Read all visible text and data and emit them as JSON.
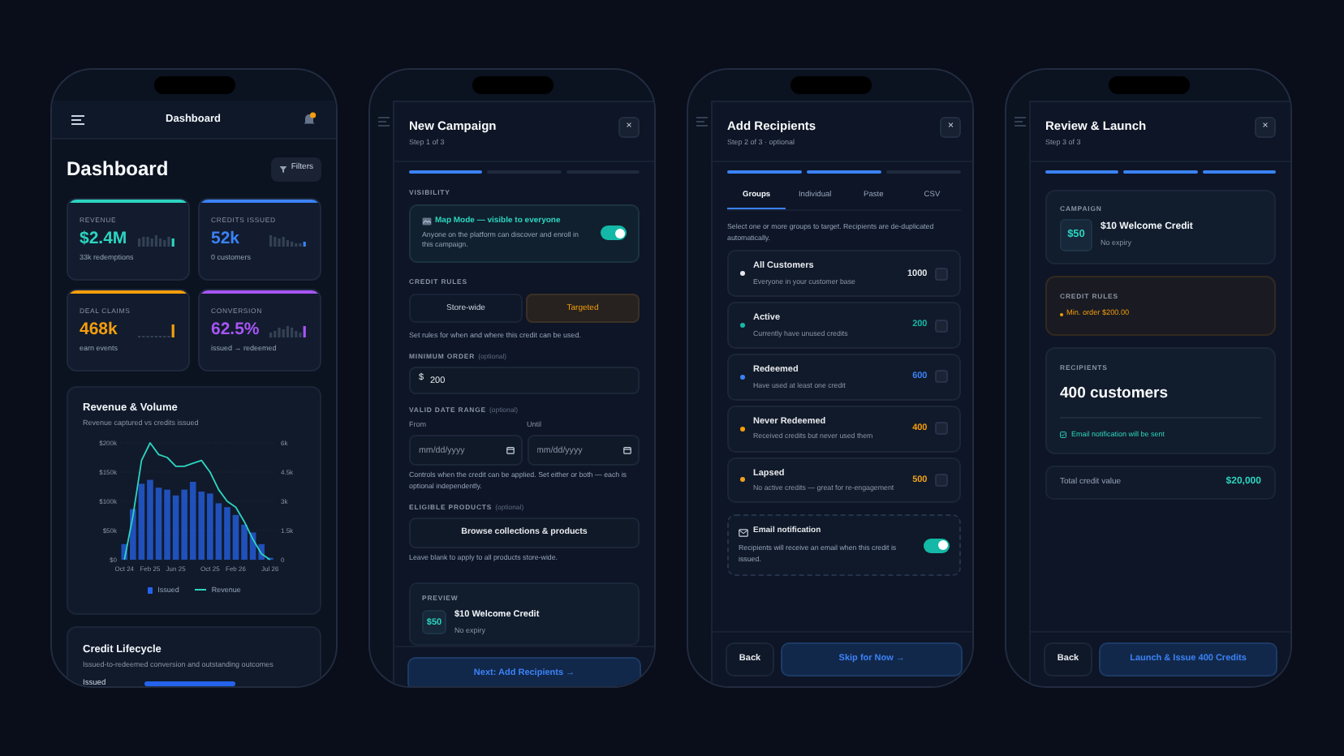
{
  "dashboard_screen": {
    "top_bar": {
      "title": "Dashboard"
    },
    "heading": "Dashboard",
    "filters_button": "Filters",
    "stats": [
      {
        "label": "REVENUE",
        "value": "$2.4M",
        "caption": "33k redemptions",
        "color": "#2dd4bf"
      },
      {
        "label": "CREDITS ISSUED",
        "value": "52k",
        "caption": "0 customers",
        "color": "#3b82f6"
      },
      {
        "label": "DEAL CLAIMS",
        "value": "468k",
        "caption": "earn events",
        "color": "#f59e0b"
      },
      {
        "label": "CONVERSION",
        "value": "62.5%",
        "caption": "issued → redeemed",
        "color": "#a855f7"
      }
    ],
    "revenue_card": {
      "title": "Revenue & Volume",
      "subtitle": "Revenue captured vs credits issued",
      "chart_data": {
        "type": "bar",
        "grid": true,
        "categories": [
          "Oct 24",
          null,
          null,
          "Feb 25",
          null,
          null,
          "Jun 25",
          null,
          null,
          null,
          "Oct 25",
          null,
          null,
          "Feb 26",
          null,
          null,
          null,
          "Jul 26"
        ],
        "ylim": [
          0,
          200000
        ],
        "y2lim": [
          0,
          6000
        ],
        "yticks": [
          {
            "value": 0,
            "label": "$0"
          },
          {
            "value": 50000,
            "label": "$50k"
          },
          {
            "value": 100000,
            "label": "$100k"
          },
          {
            "value": 150000,
            "label": "$150k"
          },
          {
            "value": 200000,
            "label": "$200k"
          }
        ],
        "y2ticks": [
          {
            "value": 0,
            "label": "0"
          },
          {
            "value": 1500,
            "label": "1.5k"
          },
          {
            "value": 3000,
            "label": "3k"
          },
          {
            "value": 4500,
            "label": "4.5k"
          },
          {
            "value": 6000,
            "label": "6k"
          }
        ],
        "series": [
          {
            "name": "Issued",
            "color": "#2563eb",
            "type": "bar",
            "axis": "y2",
            "values": [
              800,
              2600,
              3900,
              4100,
              3700,
              3600,
              3300,
              3600,
              4000,
              3500,
              3400,
              2900,
              2700,
              2300,
              1800,
              1400,
              800,
              100
            ]
          },
          {
            "name": "Revenue",
            "color": "#2dd4bf",
            "type": "line",
            "values": [
              0,
              75000,
              170000,
              200000,
              180000,
              175000,
              160000,
              160000,
              165000,
              170000,
              150000,
              120000,
              100000,
              90000,
              65000,
              35000,
              10000,
              0
            ]
          }
        ]
      }
    },
    "lifecycle_card": {
      "title": "Credit Lifecycle",
      "subtitle": "Issued-to-redeemed conversion and outstanding outcomes",
      "row_label": "Issued"
    }
  },
  "campaign_step_1": {
    "title": "New Campaign",
    "step": "Step 1 of 3",
    "close": "×",
    "steps": [
      {
        "complete": true
      },
      {
        "complete": false
      },
      {
        "complete": false
      }
    ],
    "visibility": {
      "label": "VISIBILITY",
      "title": "Map Mode — visible to everyone",
      "description": "Anyone on the platform can discover and enroll in this campaign.",
      "on": true
    },
    "credit_rules": {
      "label": "CREDIT RULES",
      "options": [
        {
          "label": "Store-wide",
          "selected": false
        },
        {
          "label": "Targeted",
          "selected": true
        }
      ],
      "help": "Set rules for when and where this credit can be used."
    },
    "minimum_order": {
      "label": "MINIMUM ORDER",
      "hint": "(optional)",
      "prefix": "$",
      "value": "200"
    },
    "date_range": {
      "label": "VALID DATE RANGE",
      "hint": "(optional)",
      "from_label": "From",
      "until_label": "Until",
      "from_placeholder": "mm/dd/yyyy",
      "until_placeholder": "mm/dd/yyyy",
      "help": "Controls when the credit can be applied. Set either or both — each is optional independently."
    },
    "eligible_products": {
      "label": "ELIGIBLE PRODUCTS",
      "hint": "(optional)",
      "button": "Browse collections & products",
      "help": "Leave blank to apply to all products store-wide."
    },
    "preview": {
      "label": "PREVIEW",
      "badge": "$50",
      "title": "$10 Welcome Credit",
      "subtitle": "No expiry"
    },
    "next_button": "Next: Add Recipients →"
  },
  "campaign_step_2": {
    "title": "Add Recipients",
    "step": "Step 2 of 3 · optional",
    "close": "×",
    "steps": [
      {
        "complete": true
      },
      {
        "complete": true
      },
      {
        "complete": false
      }
    ],
    "tabs": [
      {
        "label": "Groups",
        "selected": true
      },
      {
        "label": "Individual",
        "selected": false
      },
      {
        "label": "Paste",
        "selected": false
      },
      {
        "label": "CSV",
        "selected": false
      }
    ],
    "help": "Select one or more groups to target. Recipients are de-duplicated automatically.",
    "groups": [
      {
        "name": "All Customers",
        "description": "Everyone in your customer base",
        "count": "1000",
        "color": "#e5e7eb",
        "checked": false
      },
      {
        "name": "Active",
        "description": "Currently have unused credits",
        "count": "200",
        "color": "#14b8a6",
        "checked": false
      },
      {
        "name": "Redeemed",
        "description": "Have used at least one credit",
        "count": "600",
        "color": "#3b82f6",
        "checked": false
      },
      {
        "name": "Never Redeemed",
        "description": "Received credits but never used them",
        "count": "400",
        "color": "#f59e0b",
        "checked": false
      },
      {
        "name": "Lapsed",
        "description": "No active credits — great for re-engagement",
        "count": "500",
        "color": "#f0a020",
        "checked": false
      }
    ],
    "email": {
      "title": "Email notification",
      "description": "Recipients will receive an email when this credit is issued.",
      "on": true
    },
    "back_button": "Back",
    "next_button": "Skip for Now →"
  },
  "campaign_step_3": {
    "title": "Review & Launch",
    "step": "Step 3 of 3",
    "close": "×",
    "steps": [
      {
        "complete": true
      },
      {
        "complete": true
      },
      {
        "complete": true
      }
    ],
    "campaign": {
      "label": "CAMPAIGN",
      "badge": "$50",
      "title": "$10 Welcome Credit",
      "subtitle": "No expiry"
    },
    "credit_rules": {
      "label": "CREDIT RULES",
      "items": [
        "Min. order $200.00"
      ]
    },
    "recipients": {
      "label": "RECIPIENTS",
      "count": "400 customers",
      "note": "Email notification will be sent"
    },
    "total": {
      "label": "Total credit value",
      "value": "$20,000"
    },
    "back_button": "Back",
    "launch_button": "Launch & Issue 400 Credits"
  }
}
